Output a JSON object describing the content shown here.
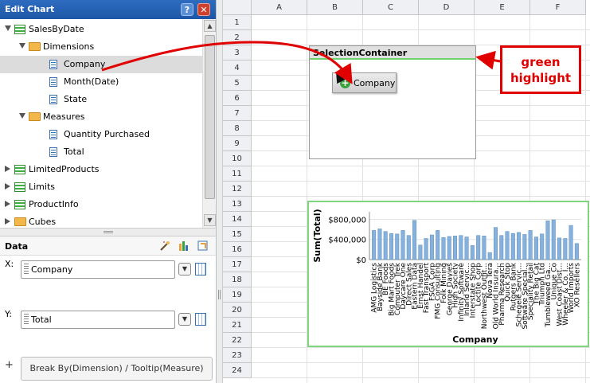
{
  "panel": {
    "title": "Edit Chart",
    "help_label": "?",
    "close_label": "✕"
  },
  "tree": [
    {
      "label": "SalesByDate",
      "icon": "table-icon",
      "expanded": true
    },
    {
      "label": "Dimensions",
      "icon": "folder-icon",
      "expanded": true
    },
    {
      "label": "Company",
      "icon": "field-icon",
      "selected": true
    },
    {
      "label": "Month(Date)",
      "icon": "field-icon"
    },
    {
      "label": "State",
      "icon": "field-icon"
    },
    {
      "label": "Measures",
      "icon": "folder-icon",
      "expanded": true
    },
    {
      "label": "Quantity Purchased",
      "icon": "field-icon"
    },
    {
      "label": "Total",
      "icon": "field-icon"
    },
    {
      "label": "LimitedProducts",
      "icon": "table-icon",
      "expanded": false
    },
    {
      "label": "Limits",
      "icon": "table-icon",
      "expanded": false
    },
    {
      "label": "ProductInfo",
      "icon": "table-icon",
      "expanded": false
    },
    {
      "label": "Cubes",
      "icon": "folder-icon",
      "expanded": false
    }
  ],
  "data_section": {
    "title": "Data",
    "x_label": "X:",
    "x_field": "Company",
    "y_label": "Y:",
    "y_field": "Total",
    "add_label": "+",
    "break_by": "Break By(Dimension) / Tooltip(Measure)"
  },
  "sheet": {
    "columns": [
      "A",
      "B",
      "C",
      "D",
      "E",
      "F"
    ],
    "rows": [
      "1",
      "2",
      "3",
      "4",
      "5",
      "6",
      "7",
      "8",
      "9",
      "10",
      "11",
      "12",
      "13",
      "14",
      "15",
      "16",
      "17",
      "18",
      "19",
      "20",
      "21",
      "22",
      "23",
      "24"
    ],
    "selection_container": "SelectionContainer",
    "dragged_chip": "Company"
  },
  "annotation": {
    "line1": "green",
    "line2": "highlight",
    "color": "#e00000"
  },
  "chart_data": {
    "type": "bar",
    "xlabel": "Company",
    "ylabel": "Sum(Total)",
    "yticks": [
      "$800,000",
      "$400,000",
      "$0"
    ],
    "ytick_values": [
      800000,
      400000,
      0
    ],
    "ylim": [
      0,
      950000
    ],
    "bar_color": "#86b1dc",
    "categories": [
      "AMG Logistics",
      "Bayside Bank",
      "BE Foods",
      "Big Mart Foods",
      "Computer Trek",
      "Daycare One",
      "Direct Sales",
      "Eastern Data",
      "Ernst Handel",
      "Fast Transport",
      "FSGA Corp",
      "FMG Consulting",
      "Folk Mining",
      "George Davies",
      "High Society",
      "Infinity Software",
      "Inland Servic...",
      "Interstate Shop",
      "Loctite Corp",
      "Northwest Outfit...",
      "Nova Tera",
      "Old World Insura...",
      "Pharma Research",
      "Quick Stop",
      "Rutgers Bank",
      "Schegele Servic...",
      "Software Special...",
      "Speciality Retail",
      "The Big Cat",
      "Triumph Ltd",
      "Tumbleweed Ga...",
      "Unique Co",
      "West Coast Dist...",
      "Wheeler & Co. I...",
      "World Imports",
      "XO Resellers"
    ],
    "values": [
      580000,
      610000,
      560000,
      520000,
      510000,
      580000,
      480000,
      780000,
      290000,
      420000,
      490000,
      580000,
      440000,
      460000,
      470000,
      480000,
      450000,
      280000,
      480000,
      470000,
      140000,
      640000,
      480000,
      560000,
      520000,
      540000,
      500000,
      580000,
      450000,
      510000,
      770000,
      790000,
      430000,
      420000,
      680000,
      320000
    ]
  }
}
